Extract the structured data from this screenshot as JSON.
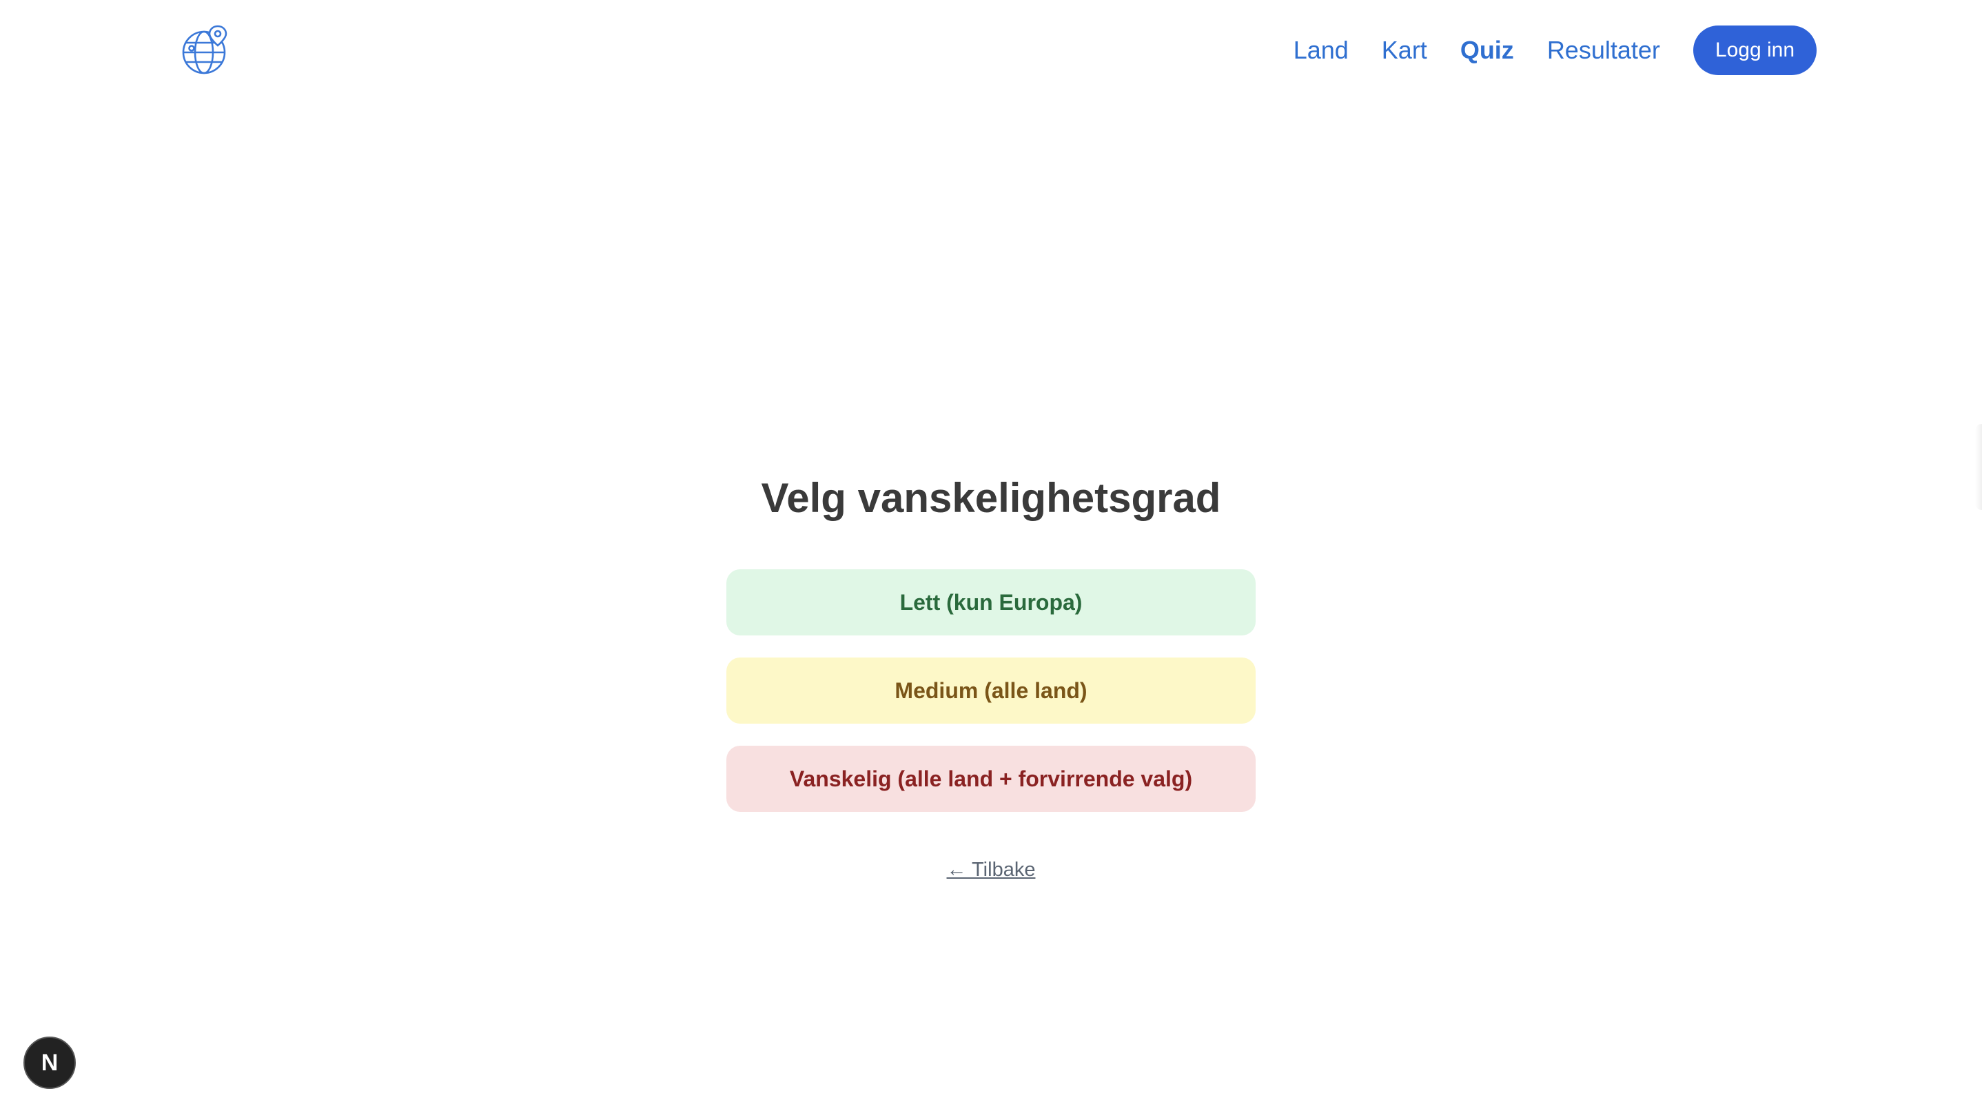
{
  "header": {
    "logo_icon": "globe-pin-icon",
    "nav": [
      {
        "label": "Land",
        "active": false
      },
      {
        "label": "Kart",
        "active": false
      },
      {
        "label": "Quiz",
        "active": true
      },
      {
        "label": "Resultater",
        "active": false
      }
    ],
    "login_label": "Logg inn"
  },
  "main": {
    "title": "Velg vanskelighetsgrad",
    "options": [
      {
        "label": "Lett (kun Europa)",
        "level": "easy"
      },
      {
        "label": "Medium (alle land)",
        "level": "medium"
      },
      {
        "label": "Vanskelig (alle land + forvirrende valg)",
        "level": "hard"
      }
    ],
    "back_label": "← Tilbake"
  },
  "dev_badge": {
    "letter": "N"
  },
  "colors": {
    "accent": "#2f62d8",
    "nav_link": "#2f6fd0",
    "easy_bg": "#e0f7e6",
    "medium_bg": "#fdf8c8",
    "hard_bg": "#f8e0e0"
  }
}
